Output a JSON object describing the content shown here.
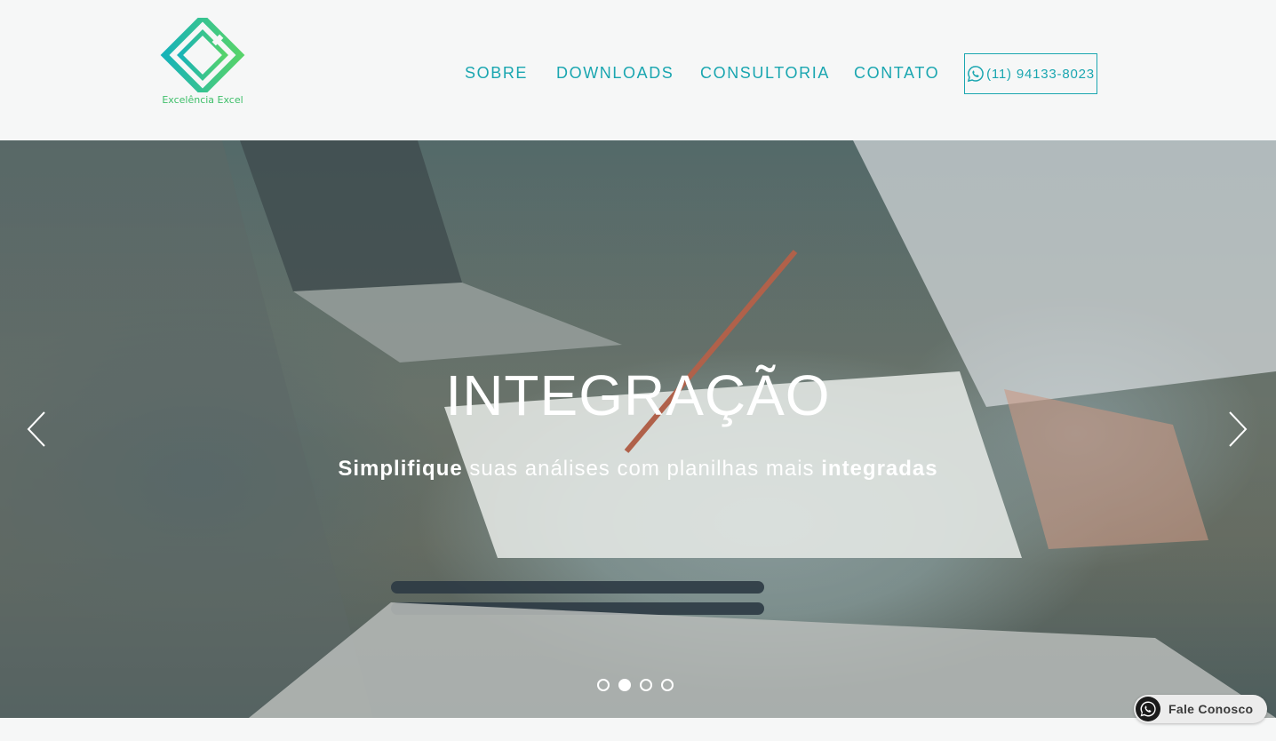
{
  "header": {
    "logo_text": "Excelência Excel",
    "nav": [
      {
        "label": "SOBRE"
      },
      {
        "label": "DOWNLOADS"
      },
      {
        "label": "CONSULTORIA"
      },
      {
        "label": "CONTATO"
      }
    ],
    "phone": "(11) 94133-8023"
  },
  "hero": {
    "title": "INTEGRAÇÃO",
    "subtitle_bold_1": "Simplifique",
    "subtitle_middle": " suas análises com planilhas mais ",
    "subtitle_bold_2": "integradas",
    "slides_count": 4,
    "active_slide": 2
  },
  "chat": {
    "label": "Fale Conosco"
  },
  "colors": {
    "accent": "#1aa6b0",
    "logo_green": "#3fbf6a",
    "background": "#f6f7f7"
  }
}
